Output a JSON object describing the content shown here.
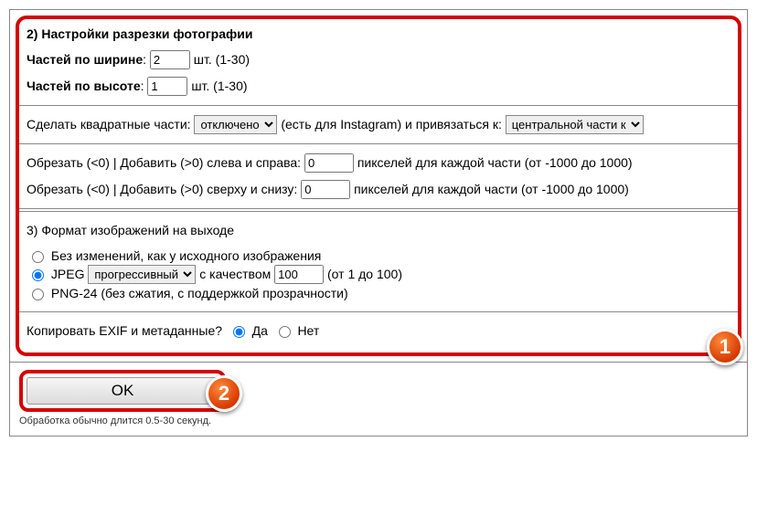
{
  "section2": {
    "heading": "2) Настройки разрезки фотографии",
    "widthLabel": "Частей по ширине",
    "widthValue": "2",
    "heightLabel": "Частей по высоте",
    "heightValue": "1",
    "unitsHint": "шт. (1-30)",
    "squareLabel": "Сделать квадратные части:",
    "squareOptions": [
      "отключено"
    ],
    "squareSelected": "отключено",
    "squareHint": "(есть для Instagram) и привязаться к:",
    "anchorOptions": [
      "центральной части к"
    ],
    "anchorSelected": "центральной части к",
    "cropHLabel": "Обрезать (<0) | Добавить (>0) слева и справа:",
    "cropHValue": "0",
    "cropVLabel": "Обрезать (<0) | Добавить (>0) сверху и снизу:",
    "cropVValue": "0",
    "pxHint": "пикселей для каждой части (от -1000 до 1000)"
  },
  "section3": {
    "heading": "3) Формат изображений на выходе",
    "optNoChange": "Без изменений, как у исходного изображения",
    "optJpegPrefix": "JPEG",
    "jpegModeOptions": [
      "прогрессивный"
    ],
    "jpegModeSelected": "прогрессивный",
    "qualityLabel": "с качеством",
    "qualityValue": "100",
    "qualityHint": "(от 1 до 100)",
    "optPng": "PNG-24 (без сжатия, с поддержкой прозрачности)",
    "exifLabel": "Копировать EXIF и метаданные?",
    "yes": "Да",
    "no": "Нет"
  },
  "bottom": {
    "ok": "OK",
    "hint": "Обработка обычно длится 0.5-30 секунд."
  },
  "badges": {
    "b1": "1",
    "b2": "2"
  }
}
